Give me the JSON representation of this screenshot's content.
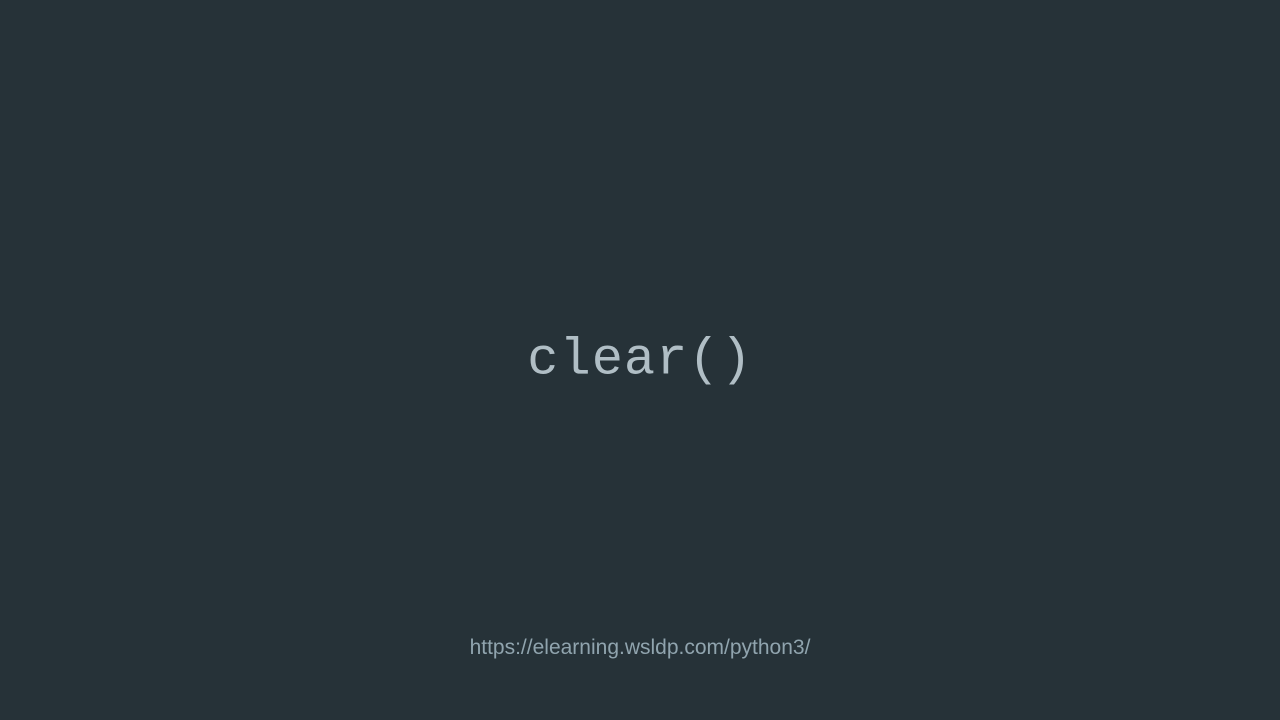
{
  "slide": {
    "main_text": "clear()",
    "footer_url": "https://elearning.wsldp.com/python3/"
  },
  "colors": {
    "background": "#263238",
    "main_text": "#B0BEC5",
    "footer_text": "#90A4AE"
  }
}
